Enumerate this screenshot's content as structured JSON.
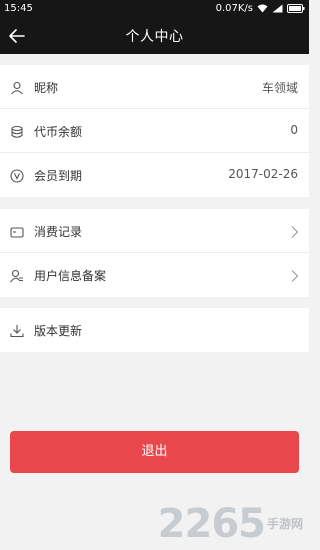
{
  "status_bar": {
    "time": "15:45",
    "speed": "0.07K/s"
  },
  "header": {
    "title": "个人中心",
    "back_icon": "back-arrow-icon"
  },
  "profile": {
    "nickname": {
      "label": "昵称",
      "value": "车领域",
      "icon": "user-icon"
    },
    "balance": {
      "label": "代币余额",
      "value": "0",
      "icon": "coins-icon"
    },
    "membership": {
      "label": "会员到期",
      "value": "2017-02-26",
      "icon": "vip-icon"
    }
  },
  "records": {
    "consumption": {
      "label": "消费记录",
      "icon": "card-icon"
    },
    "registration": {
      "label": "用户信息备案",
      "icon": "user-settings-icon"
    }
  },
  "update": {
    "label": "版本更新",
    "icon": "download-icon"
  },
  "logout_label": "退出",
  "watermark": {
    "number": "2265",
    "text": "手游网"
  }
}
